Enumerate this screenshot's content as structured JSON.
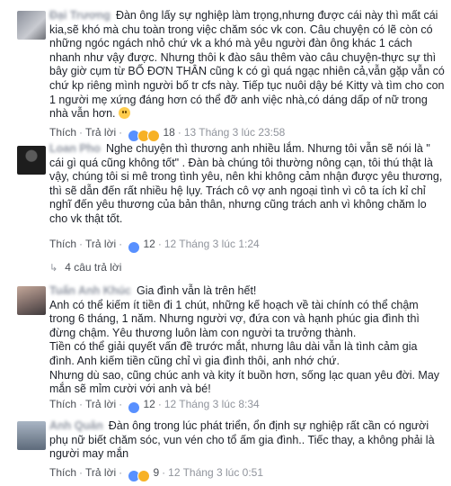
{
  "comments": [
    {
      "name": "Đại Trương",
      "text": "Đàn ông lấy sự nghiệp làm trọng,nhưng được cái này thì mất cái kia,sẽ khó mà chu toàn trong việc chăm sóc vk con. Câu chuyện có lẽ còn có những ngóc ngách nhỏ chứ vk a khó mà yêu người đàn ông khác 1 cách nhanh như vậy được. Nhưng thôi k đào sâu thêm vào câu chuyện-thực sự thì bây giờ cụm từ BỐ ĐƠN THÂN cũng k có gì quá ngạc nhiên cả,vẫn gặp vẫn có chứ kp riêng mình người bố tr cfs này. Tiếp tục nuôi dậy bé Kitty và tìm cho con 1 người mẹ xứng đáng hơn có thể đỡ anh việc nhà,có dáng dấp of nữ trong nhà vẫn hơn.",
      "like": "Thích",
      "reply": "Trả lời",
      "reaction_count": "18",
      "time": "13 Tháng 3 lúc 23:58"
    },
    {
      "name": "Loan Pho",
      "text": "Nghe chuyện thì thương anh nhiều lắm. Nhưng tôi vẫn sẽ nói là \" cái gì quá cũng không tốt\" . Đàn bà chúng tôi thường nông cạn, tôi thú thật là vậy, chúng tôi si mê trong tình yêu, nên khi không cảm nhận được yêu thương, thì sẽ dẫn đến rất nhiều hệ lụy. Trách cô vợ anh ngoại tình vì cô ta ích kỉ chỉ nghĩ đến yêu thương của bản thân, nhưng cũng trách anh vì không chăm lo cho vk thật tốt.",
      "like": "Thích",
      "reply": "Trả lời",
      "reaction_count": "12",
      "time": "12 Tháng 3 lúc 1:24",
      "replies_label": "4 câu trả lời"
    },
    {
      "name": "Tuấn Anh Khúc",
      "text": "Gia đình vẫn là trên hết!\nAnh có thể kiếm ít tiền đi 1 chút, những kế hoạch về tài chính có thể chậm trong 6 tháng, 1 năm. Nhưng người vợ, đứa con và hạnh phúc gia đình thì đừng chậm. Yêu thương luôn làm con người ta trưởng thành.\nTiền có thể giải quyết vấn đề trước mắt, nhưng lâu dài vẫn là tình cảm gia đình. Anh kiếm tiền cũng chỉ vì gia đình thôi, anh nhớ chứ.\nNhưng dù sao, cũng chúc anh và kity ít buồn hơn, sống lạc quan yêu đời. May mắn sẽ mỉm cười với anh và bé!",
      "like": "Thích",
      "reply": "Trả lời",
      "reaction_count": "12",
      "time": "12 Tháng 3 lúc 8:34"
    },
    {
      "name": "Anh Quân",
      "text": "Đàn ông trong lúc phát triển, ổn định sự nghiệp rất cần có người phụ nữ biết chăm sóc, vun vén cho tổ ấm gia đình.. Tiếc thay, a không phải là người may mắn",
      "like": "Thích",
      "reply": "Trả lời",
      "reaction_count": "9",
      "time": "12 Tháng 3 lúc 0:51"
    }
  ],
  "colors": {
    "text": "#1d2129",
    "link": "#4b4f56",
    "muted": "#90949c",
    "like": "#5890ff",
    "haha": "#f7b125"
  }
}
